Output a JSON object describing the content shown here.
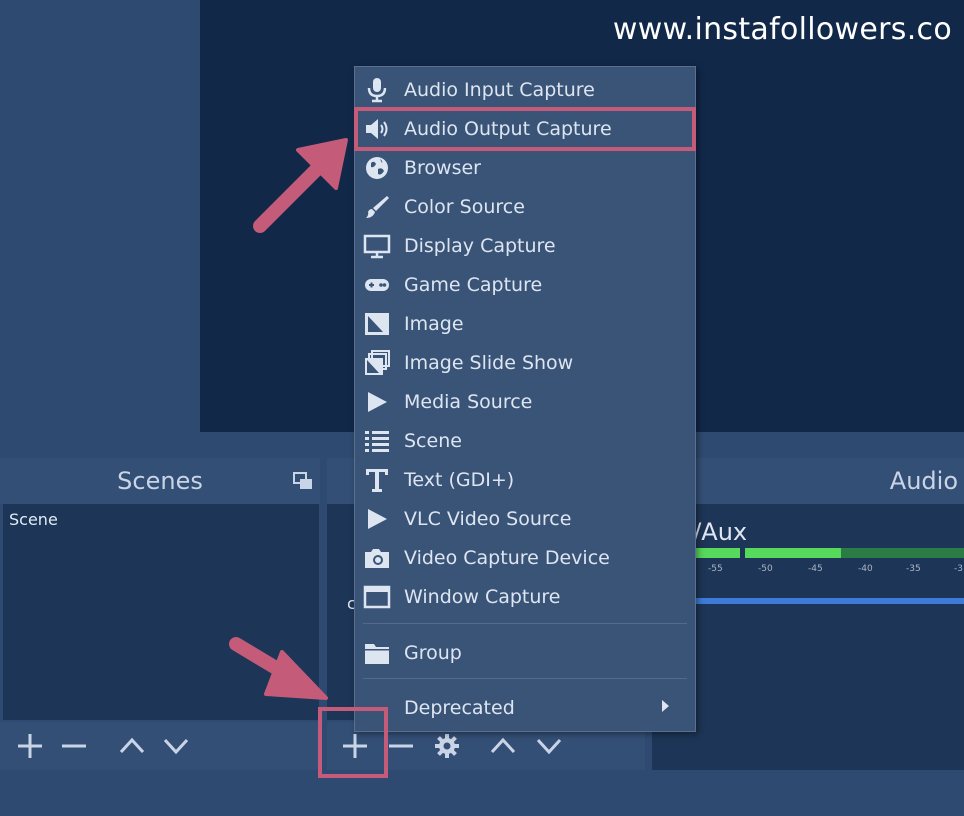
{
  "watermark": "www.instafollowers.co",
  "scenes": {
    "title": "Scenes",
    "items": [
      "Scene"
    ]
  },
  "sources": {
    "partial_text": "c"
  },
  "audio": {
    "title": "Audio",
    "channel_label": "c/Aux",
    "ticks": [
      "-55",
      "-50",
      "-45",
      "-40",
      "-35",
      "-3"
    ]
  },
  "menu": {
    "items": [
      {
        "label": "Audio Input Capture",
        "icon": "microphone-icon"
      },
      {
        "label": "Audio Output Capture",
        "icon": "speaker-icon"
      },
      {
        "label": "Browser",
        "icon": "globe-icon"
      },
      {
        "label": "Color Source",
        "icon": "brush-icon"
      },
      {
        "label": "Display Capture",
        "icon": "monitor-icon"
      },
      {
        "label": "Game Capture",
        "icon": "gamepad-icon"
      },
      {
        "label": "Image",
        "icon": "image-icon"
      },
      {
        "label": "Image Slide Show",
        "icon": "slideshow-icon"
      },
      {
        "label": "Media Source",
        "icon": "play-icon"
      },
      {
        "label": "Scene",
        "icon": "list-icon"
      },
      {
        "label": "Text (GDI+)",
        "icon": "text-icon"
      },
      {
        "label": "VLC Video Source",
        "icon": "play-icon"
      },
      {
        "label": "Video Capture Device",
        "icon": "camera-icon"
      },
      {
        "label": "Window Capture",
        "icon": "window-icon"
      }
    ],
    "group_label": "Group",
    "deprecated_label": "Deprecated"
  },
  "colors": {
    "highlight": "#c45b79",
    "background": "#2b4266",
    "canvas": "#112849",
    "meter_green": "#57d95c",
    "volume_blue": "#3c7cd8"
  }
}
